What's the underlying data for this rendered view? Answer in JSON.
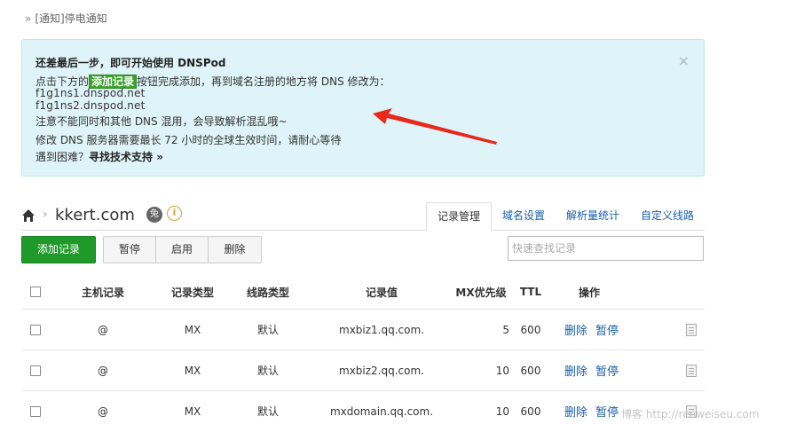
{
  "notice": {
    "link_text": "[通知]停电通知"
  },
  "alert": {
    "title": "还差最后一步，即可开始使用 DNSPod",
    "line1_prefix": "点击下方的",
    "line1_badge": "添加记录",
    "line1_suffix": "按钮完成添加，再到域名注册的地方将 DNS 修改为：",
    "ns1": "f1g1ns1.dnspod.net",
    "ns2": "f1g1ns2.dnspod.net",
    "warning": "注意不能同时和其他 DNS 混用，会导致解析混乱哦~",
    "propagation": "修改 DNS 服务器需要最长 72 小时的全球生效时间，请耐心等待",
    "help_prefix": "遇到困难？",
    "help_link": "寻找技术支持 »",
    "close_label": "×"
  },
  "domain": {
    "name": "kkert.com",
    "rabbit_label": "兔",
    "info_label": "i"
  },
  "tabs": [
    {
      "label": "记录管理",
      "active": true
    },
    {
      "label": "域名设置",
      "active": false
    },
    {
      "label": "解析量统计",
      "active": false
    },
    {
      "label": "自定义线路",
      "active": false
    }
  ],
  "toolbar": {
    "add_label": "添加记录",
    "pause_label": "暂停",
    "enable_label": "启用",
    "delete_label": "删除",
    "search_placeholder": "快速查找记录"
  },
  "table": {
    "headers": {
      "host": "主机记录",
      "type": "记录类型",
      "line": "线路类型",
      "value": "记录值",
      "mx": "MX优先级",
      "ttl": "TTL",
      "op": "操作"
    },
    "rows": [
      {
        "host": "@",
        "type": "MX",
        "line": "默认",
        "value": "mxbiz1.qq.com.",
        "mx": "5",
        "ttl": "600",
        "op_delete": "删除",
        "op_pause": "暂停"
      },
      {
        "host": "@",
        "type": "MX",
        "line": "默认",
        "value": "mxbiz2.qq.com.",
        "mx": "10",
        "ttl": "600",
        "op_delete": "删除",
        "op_pause": "暂停"
      },
      {
        "host": "@",
        "type": "MX",
        "line": "默认",
        "value": "mxdomain.qq.com.",
        "mx": "10",
        "ttl": "600",
        "op_delete": "删除",
        "op_pause": "暂停"
      }
    ]
  },
  "watermark": "博客 http://renweiseu.com"
}
